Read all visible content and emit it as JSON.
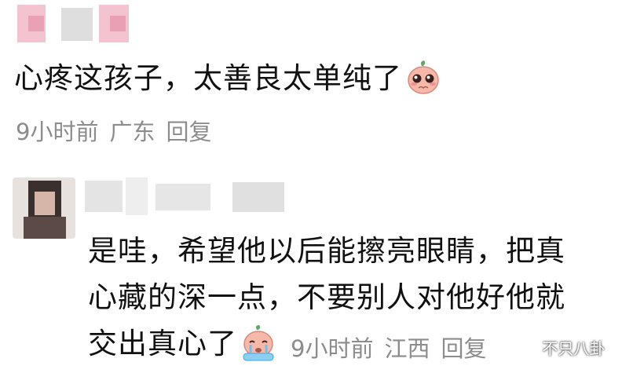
{
  "comment1": {
    "text": "心疼这孩子，太善良太单纯了",
    "emoji": "pleading-peach-emoji",
    "time": "9小时前",
    "location": "广东",
    "reply": "回复"
  },
  "comment2": {
    "lines": [
      "是哇，希望他以后能擦亮眼睛，把真",
      "心藏的深一点，不要别人对他好他就",
      "交出真心了"
    ],
    "emoji": "crying-peach-emoji",
    "time": "9小时前",
    "location": "江西",
    "reply": "回复"
  },
  "watermark": {
    "text": "不只八卦",
    "icon": "wechat-icon"
  },
  "colors": {
    "text": "#111111",
    "meta": "#8c8c8c",
    "background": "#ffffff",
    "emoji_peach": "#f4b3a6",
    "emoji_leaf": "#5fa865"
  }
}
